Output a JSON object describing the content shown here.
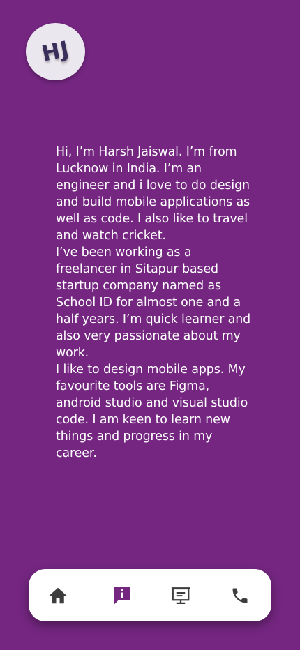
{
  "logo": {
    "initials": "HJ"
  },
  "about": {
    "paragraphs": [
      "Hi, I’m Harsh Jaiswal. I’m from Lucknow in India. I’m an engineer and i love to do design and build mobile applications as well as code. I also like to travel and watch cricket.",
      "I’ve been working as a freelancer in Sitapur based startup company named as School ID for almost one and a half years. I’m quick learner and also very passionate about my work.",
      "I like to design mobile apps. My favourite  tools are Figma, android studio and visual studio code. I am keen to learn new things and progress in my career."
    ]
  },
  "nav": {
    "items": [
      {
        "icon": "home-icon",
        "active": false
      },
      {
        "icon": "info-icon",
        "active": true
      },
      {
        "icon": "presentation-icon",
        "active": false
      },
      {
        "icon": "phone-icon",
        "active": false
      }
    ]
  },
  "colors": {
    "background": "#742680",
    "active_icon": "#742680",
    "inactive_icon": "#3d3d3d",
    "nav_background": "#ffffff",
    "logo_background": "#ebe7ee",
    "logo_text": "#3a2f5a"
  }
}
